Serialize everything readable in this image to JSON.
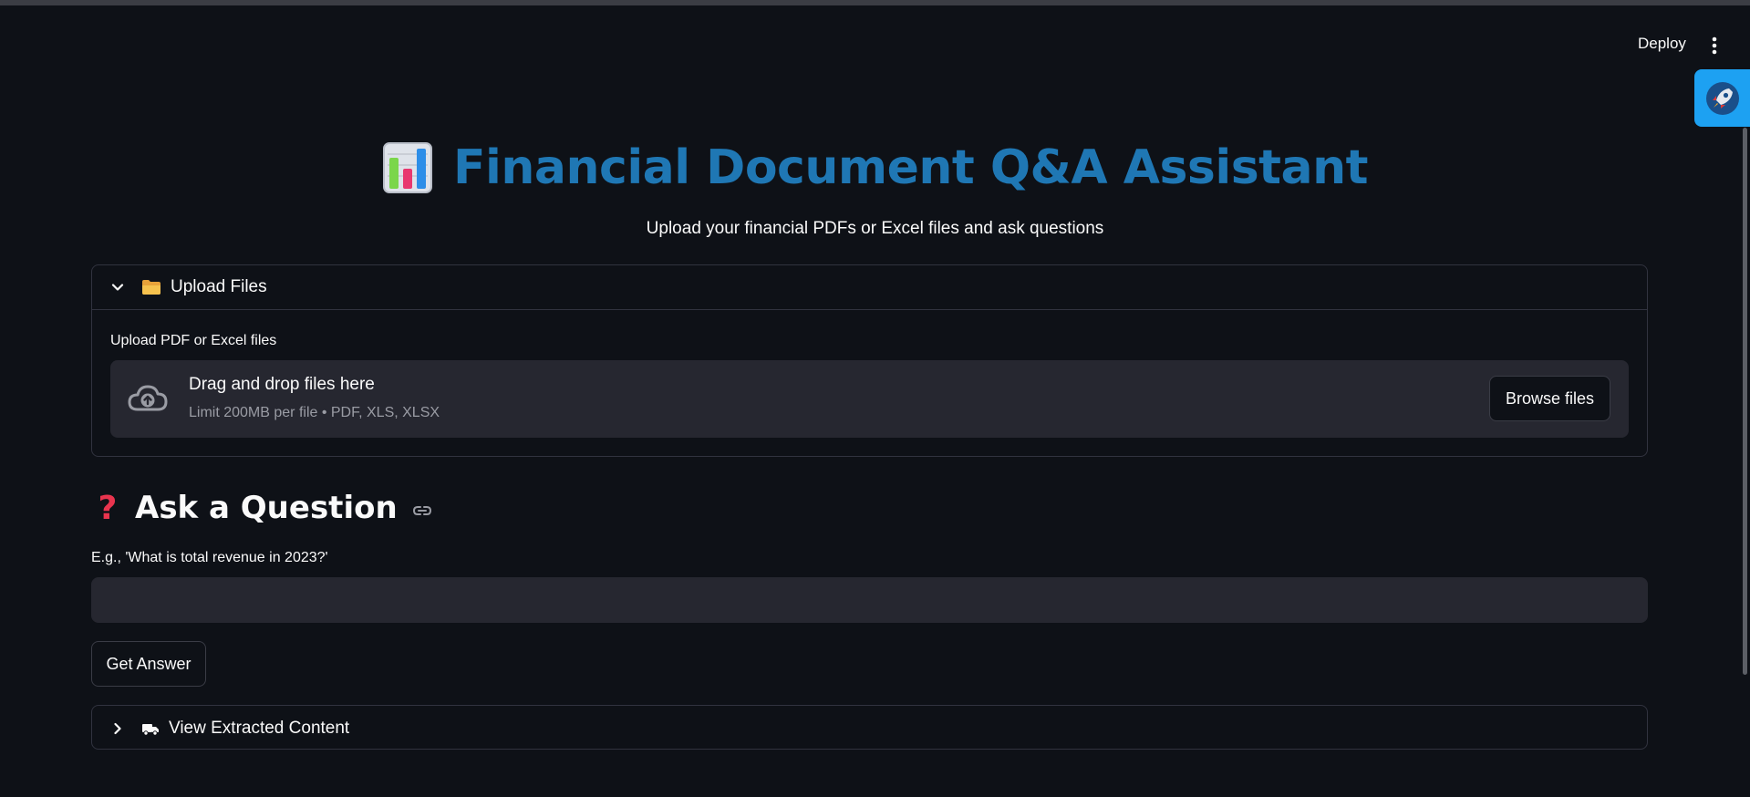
{
  "header": {
    "deploy_label": "Deploy",
    "menu_icon": "more-vertical-icon"
  },
  "floating_tab": {
    "icon": "rocket-icon",
    "color": "#1da1f2"
  },
  "title": {
    "emoji": "bar-chart-icon",
    "text": "Financial Document Q&A Assistant",
    "color": "#1f77b4"
  },
  "subtitle": "Upload your financial PDFs or Excel files and ask questions",
  "upload_expander": {
    "label": "Upload Files",
    "icon": "folder-icon",
    "expanded": true,
    "uploader": {
      "label": "Upload PDF or Excel files",
      "drop_text": "Drag and drop files here",
      "limit_text": "Limit 200MB per file • PDF, XLS, XLSX",
      "browse_label": "Browse files"
    }
  },
  "question_section": {
    "icon": "question-mark-icon",
    "heading": "Ask a Question",
    "input_label": "E.g., 'What is total revenue in 2023?'",
    "input_value": "",
    "button_label": "Get Answer"
  },
  "extracted_expander": {
    "label": "View Extracted Content",
    "icon": "truck-icon",
    "expanded": false
  },
  "colors": {
    "background": "#0e1117",
    "surface": "#262730",
    "border": "#31333f",
    "accent": "#1f77b4"
  }
}
